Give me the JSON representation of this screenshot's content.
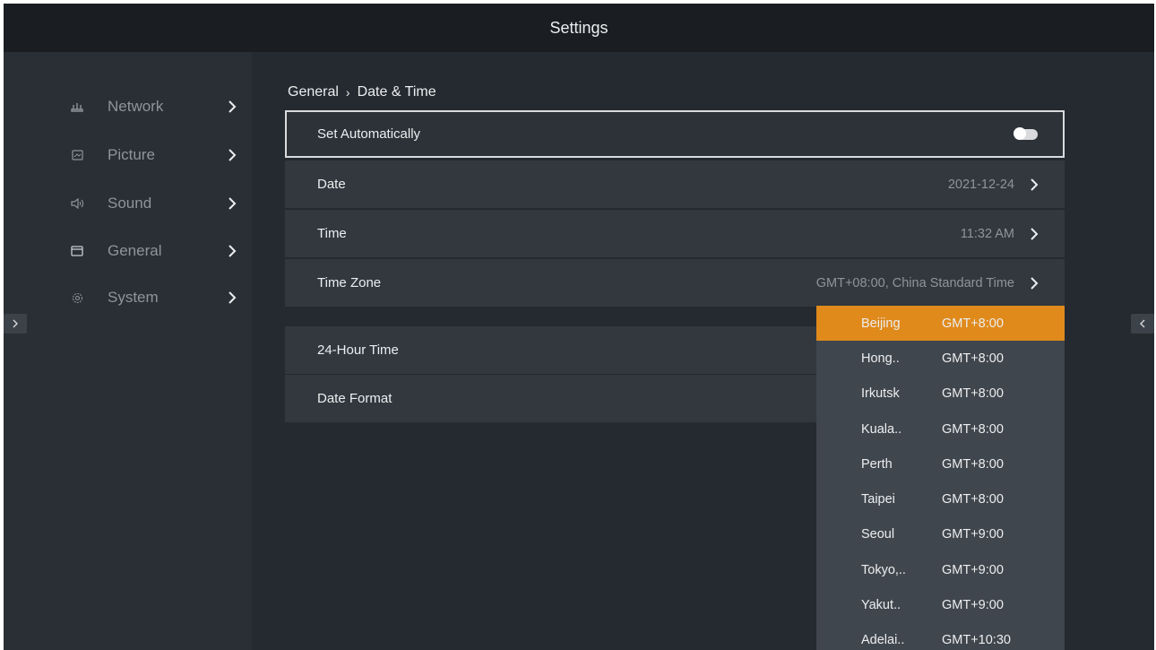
{
  "header": {
    "title": "Settings"
  },
  "sidebar": {
    "items": [
      {
        "label": "Network",
        "icon": "network-icon"
      },
      {
        "label": "Picture",
        "icon": "picture-icon"
      },
      {
        "label": "Sound",
        "icon": "sound-icon"
      },
      {
        "label": "General",
        "icon": "general-icon"
      },
      {
        "label": "System",
        "icon": "system-icon"
      }
    ]
  },
  "breadcrumb": {
    "parent": "General",
    "separator": "›",
    "current": "Date & Time"
  },
  "settings": {
    "set_automatically": {
      "label": "Set Automatically",
      "enabled": false
    },
    "date": {
      "label": "Date",
      "value": "2021-12-24"
    },
    "time": {
      "label": "Time",
      "value": "11:32 AM"
    },
    "time_zone": {
      "label": "Time Zone",
      "value": "GMT+08:00, China Standard Time"
    },
    "hour24": {
      "label": "24-Hour Time"
    },
    "date_format": {
      "label": "Date Format"
    }
  },
  "timezone_dropdown": {
    "selected_index": 0,
    "items": [
      {
        "city": "Beijing",
        "offset": "GMT+8:00"
      },
      {
        "city": "Hong..",
        "offset": "GMT+8:00"
      },
      {
        "city": "Irkutsk",
        "offset": "GMT+8:00"
      },
      {
        "city": "Kuala..",
        "offset": "GMT+8:00"
      },
      {
        "city": "Perth",
        "offset": "GMT+8:00"
      },
      {
        "city": "Taipei",
        "offset": "GMT+8:00"
      },
      {
        "city": "Seoul",
        "offset": "GMT+9:00"
      },
      {
        "city": "Tokyo,..",
        "offset": "GMT+9:00"
      },
      {
        "city": "Yakut..",
        "offset": "GMT+9:00"
      },
      {
        "city": "Adelai..",
        "offset": "GMT+10:30"
      }
    ]
  },
  "colors": {
    "background": "#252a30",
    "topbar": "#1a1d21",
    "sidebar": "#2a2f35",
    "row": "#32383e",
    "dropdown": "#40464d",
    "accent": "#e08a1c"
  }
}
